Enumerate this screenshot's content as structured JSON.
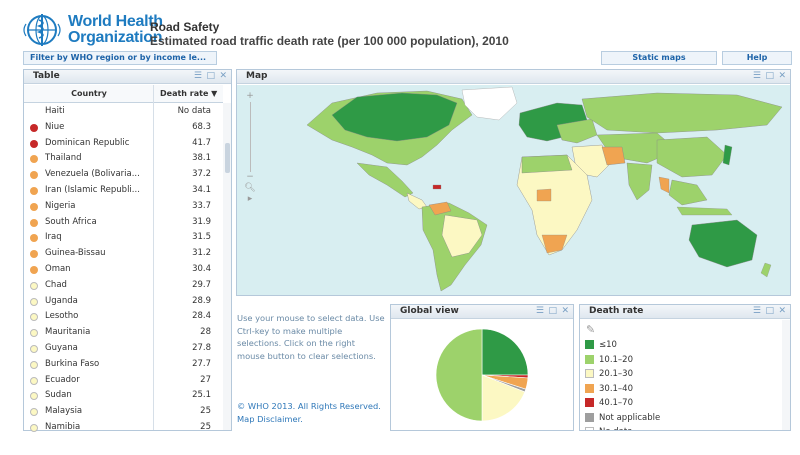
{
  "header": {
    "org_name_line1": "World Health",
    "org_name_line2": "Organization",
    "title": "Road Safety",
    "subtitle": "Estimated road traffic death rate (per 100 000 population), 2010"
  },
  "toolbar": {
    "filter_label": "Filter by WHO region or by income le...",
    "static_maps_label": "Static maps",
    "help_label": "Help"
  },
  "table_panel": {
    "title": "Table",
    "col_country": "Country",
    "col_rate": "Death rate ▼",
    "rows": [
      {
        "country": "Haiti",
        "rate": "No data",
        "color": ""
      },
      {
        "country": "Niue",
        "rate": "68.3",
        "color": "#c62828"
      },
      {
        "country": "Dominican Republic",
        "rate": "41.7",
        "color": "#c62828"
      },
      {
        "country": "Thailand",
        "rate": "38.1",
        "color": "#f0a451"
      },
      {
        "country": "Venezuela (Bolivaria...",
        "rate": "37.2",
        "color": "#f0a451"
      },
      {
        "country": "Iran (Islamic Republi...",
        "rate": "34.1",
        "color": "#f0a451"
      },
      {
        "country": "Nigeria",
        "rate": "33.7",
        "color": "#f0a451"
      },
      {
        "country": "South Africa",
        "rate": "31.9",
        "color": "#f0a451"
      },
      {
        "country": "Iraq",
        "rate": "31.5",
        "color": "#f0a451"
      },
      {
        "country": "Guinea-Bissau",
        "rate": "31.2",
        "color": "#f0a451"
      },
      {
        "country": "Oman",
        "rate": "30.4",
        "color": "#f0a451"
      },
      {
        "country": "Chad",
        "rate": "29.7",
        "color": "#fcf8c3"
      },
      {
        "country": "Uganda",
        "rate": "28.9",
        "color": "#fcf8c3"
      },
      {
        "country": "Lesotho",
        "rate": "28.4",
        "color": "#fcf8c3"
      },
      {
        "country": "Mauritania",
        "rate": "28",
        "color": "#fcf8c3"
      },
      {
        "country": "Guyana",
        "rate": "27.8",
        "color": "#fcf8c3"
      },
      {
        "country": "Burkina Faso",
        "rate": "27.7",
        "color": "#fcf8c3"
      },
      {
        "country": "Ecuador",
        "rate": "27",
        "color": "#fcf8c3"
      },
      {
        "country": "Sudan",
        "rate": "25.1",
        "color": "#fcf8c3"
      },
      {
        "country": "Malaysia",
        "rate": "25",
        "color": "#fcf8c3"
      },
      {
        "country": "Namibia",
        "rate": "25",
        "color": "#fcf8c3"
      }
    ]
  },
  "map_panel": {
    "title": "Map",
    "zoom_in": "+",
    "zoom_out": "−"
  },
  "info": {
    "instructions": "Use your mouse to select data.  Use Ctrl-key to make multiple selections. Click on the right mouse button to clear selections.",
    "copyright": "© WHO 2013. All Rights Reserved. Map Disclaimer."
  },
  "global_view": {
    "title": "Global view",
    "chart_data": {
      "type": "pie",
      "slices": [
        {
          "category": "≤10",
          "share": 0.25,
          "color": "#2f9a46"
        },
        {
          "category": "40.1–70",
          "share": 0.01,
          "color": "#c62828"
        },
        {
          "category": "30.1–40",
          "share": 0.04,
          "color": "#f0a451"
        },
        {
          "category": "Not applicable",
          "share": 0.01,
          "color": "#9e9e9e"
        },
        {
          "category": "20.1–30",
          "share": 0.19,
          "color": "#fcf8c3"
        },
        {
          "category": "10.1–20",
          "share": 0.5,
          "color": "#9dd26b"
        }
      ]
    }
  },
  "legend_panel": {
    "title": "Death rate",
    "items": [
      {
        "label": "≤10",
        "color": "#2f9a46"
      },
      {
        "label": "10.1–20",
        "color": "#9dd26b"
      },
      {
        "label": "20.1–30",
        "color": "#fcf8c3"
      },
      {
        "label": "30.1–40",
        "color": "#f0a451"
      },
      {
        "label": "40.1–70",
        "color": "#c62828"
      },
      {
        "label": "Not applicable",
        "color": "#9e9e9e"
      },
      {
        "label": "No data",
        "color": "#ffffff"
      }
    ]
  },
  "colors": {
    "brand_blue": "#1e7bc0",
    "ocean": "#d8eef1"
  }
}
